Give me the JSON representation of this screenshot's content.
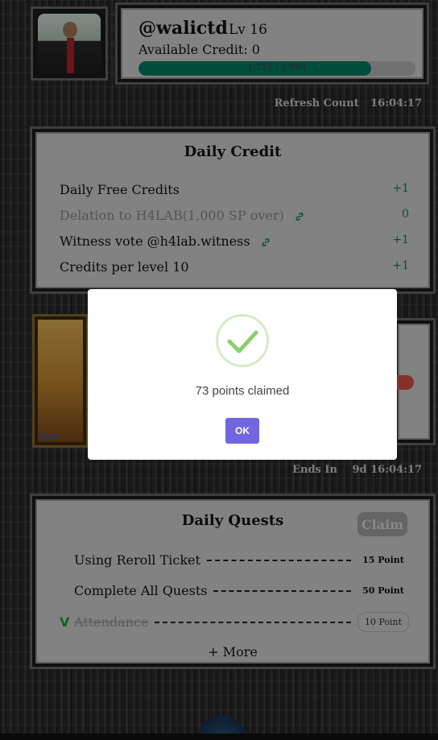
{
  "profile": {
    "username": "@walictd",
    "level": "Lv 16",
    "available_credit": "Available Credit: 0",
    "xp_text": "1,711 / 1,984",
    "xp_progress": 0.84
  },
  "refresh": {
    "label": "Refresh Count",
    "time": "16:04:17"
  },
  "daily_credit": {
    "title": "Daily Credit",
    "rows": [
      {
        "label": "Daily Free Credits",
        "value": "+1"
      },
      {
        "label": "Delation to H4LAB(1,000 SP over)",
        "value": "0"
      },
      {
        "label": "Witness vote @h4lab.witness",
        "value": "+1"
      },
      {
        "label": "Credits per level 10",
        "value": "+1"
      }
    ]
  },
  "card": {
    "label": "Stak"
  },
  "ends": {
    "label": "Ends In",
    "time": "9d 16:04:17"
  },
  "daily_quests": {
    "title": "Daily Quests",
    "claim_label": "Claim",
    "quests": [
      {
        "check": "",
        "name": "Using Reroll Ticket",
        "points": "15 Point"
      },
      {
        "check": "",
        "name": "Complete All Quests",
        "points": "50 Point"
      },
      {
        "check": "V",
        "name": "Attendance",
        "points": "10 Point"
      }
    ],
    "more_label": "+ More"
  },
  "modal": {
    "message": "73 points claimed",
    "ok_label": "OK"
  },
  "colors": {
    "accent": "#7166e0",
    "progress": "#00806a",
    "success": "#8ccf6a"
  }
}
